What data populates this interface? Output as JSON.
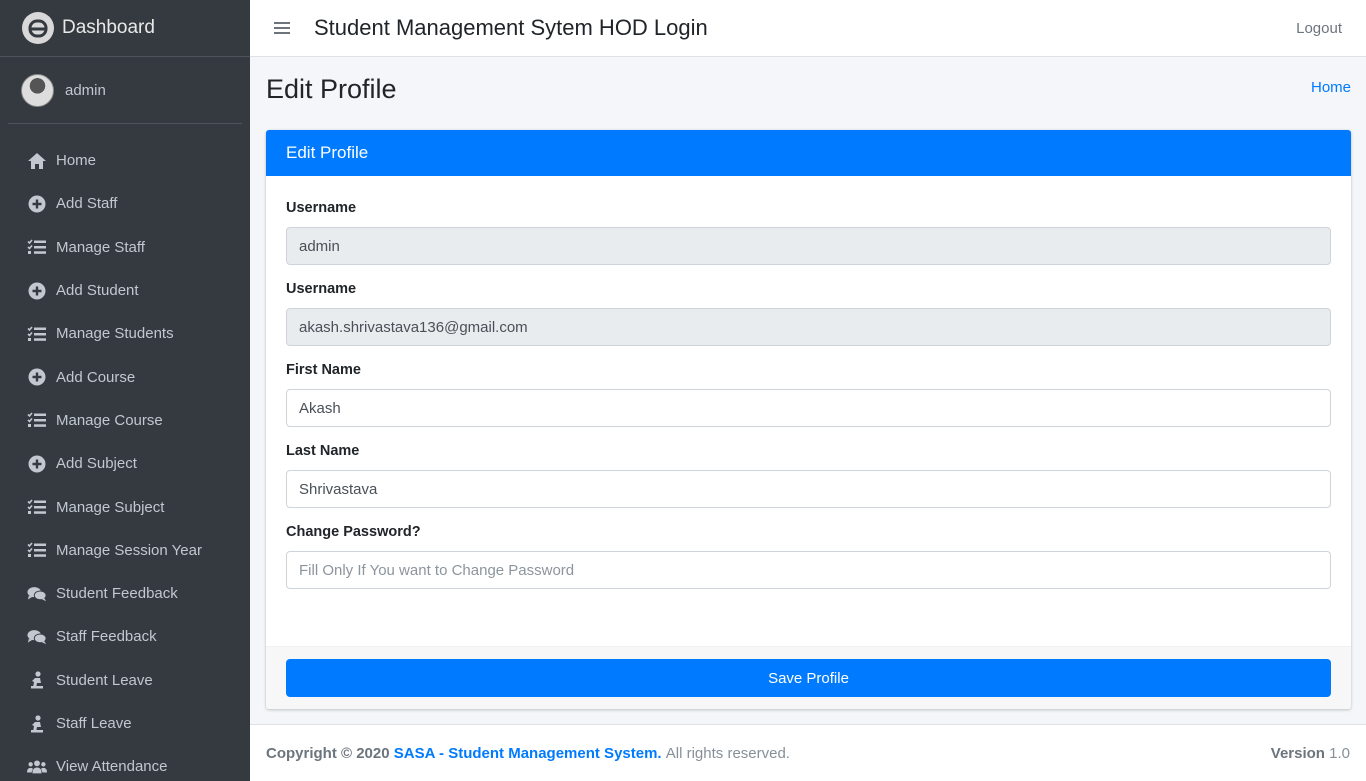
{
  "sidebar": {
    "brand": "Dashboard",
    "user": "admin",
    "items": [
      {
        "label": "Home",
        "icon": "home-icon"
      },
      {
        "label": "Add Staff",
        "icon": "plus-circle-icon"
      },
      {
        "label": "Manage Staff",
        "icon": "tasks-icon"
      },
      {
        "label": "Add Student",
        "icon": "plus-circle-icon"
      },
      {
        "label": "Manage Students",
        "icon": "tasks-icon"
      },
      {
        "label": "Add Course",
        "icon": "plus-circle-icon"
      },
      {
        "label": "Manage Course",
        "icon": "tasks-icon"
      },
      {
        "label": "Add Subject",
        "icon": "plus-circle-icon"
      },
      {
        "label": "Manage Subject",
        "icon": "tasks-icon"
      },
      {
        "label": "Manage Session Year",
        "icon": "tasks-icon"
      },
      {
        "label": "Student Feedback",
        "icon": "comments-icon"
      },
      {
        "label": "Staff Feedback",
        "icon": "comments-icon"
      },
      {
        "label": "Student Leave",
        "icon": "person-icon"
      },
      {
        "label": "Staff Leave",
        "icon": "person-icon"
      },
      {
        "label": "View Attendance",
        "icon": "users-icon"
      }
    ]
  },
  "topbar": {
    "title": "Student Management Sytem HOD Login",
    "logout": "Logout"
  },
  "header": {
    "title": "Edit Profile",
    "breadcrumb_home": "Home"
  },
  "card": {
    "title": "Edit Profile",
    "fields": [
      {
        "label": "Username",
        "value": "admin",
        "placeholder": "",
        "readonly": true
      },
      {
        "label": "Username",
        "value": "akash.shrivastava136@gmail.com",
        "placeholder": "",
        "readonly": true
      },
      {
        "label": "First Name",
        "value": "Akash",
        "placeholder": "",
        "readonly": false
      },
      {
        "label": "Last Name",
        "value": "Shrivastava",
        "placeholder": "",
        "readonly": false
      },
      {
        "label": "Change Password?",
        "value": "",
        "placeholder": "Fill Only If You want to Change Password",
        "readonly": false
      }
    ],
    "save_label": "Save Profile"
  },
  "footer": {
    "copyright": "Copyright © 2020",
    "brand": "SASA - Student Management System.",
    "rights": "All rights reserved.",
    "version_label": "Version",
    "version": "1.0"
  },
  "colors": {
    "sidebar_bg": "#343a40",
    "primary": "#007bff",
    "content_bg": "#f4f6f9"
  }
}
